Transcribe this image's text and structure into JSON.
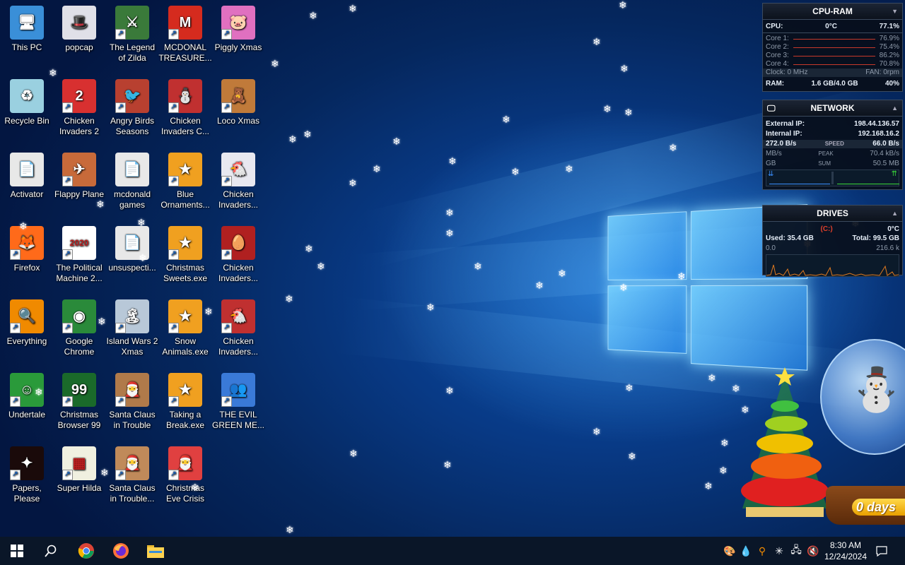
{
  "desktop_icons": [
    {
      "label": "This PC",
      "glyph": "🖥",
      "color": "#3a8fd8",
      "shortcut": false
    },
    {
      "label": "popcap",
      "glyph": "🎩",
      "color": "#e0e0e8",
      "shortcut": false
    },
    {
      "label": "The Legend of Zilda",
      "glyph": "⚔",
      "color": "#3a7a3a",
      "shortcut": true
    },
    {
      "label": "MCDONAL TREASURE...",
      "glyph": "M",
      "color": "#d52b1e",
      "shortcut": true
    },
    {
      "label": "Piggly Xmas",
      "glyph": "🐷",
      "color": "#e070c0",
      "shortcut": true
    },
    {
      "label": "Recycle Bin",
      "glyph": "♻",
      "color": "#9ad0e0",
      "shortcut": false
    },
    {
      "label": "Chicken Invaders 2",
      "glyph": "2",
      "color": "#d83030",
      "shortcut": true
    },
    {
      "label": "Angry Birds Seasons",
      "glyph": "🐦",
      "color": "#b84030",
      "shortcut": true
    },
    {
      "label": "Chicken Invaders C...",
      "glyph": "⛄",
      "color": "#c03030",
      "shortcut": true
    },
    {
      "label": "Loco Xmas",
      "glyph": "🧸",
      "color": "#c07a3a",
      "shortcut": true
    },
    {
      "label": "Activator",
      "glyph": "📄",
      "color": "#e8e8e8",
      "shortcut": false
    },
    {
      "label": "Flappy Plane",
      "glyph": "✈",
      "color": "#c86a3a",
      "shortcut": true
    },
    {
      "label": "mcdonald games",
      "glyph": "📄",
      "color": "#e8e8e8",
      "shortcut": false
    },
    {
      "label": "Blue Ornaments...",
      "glyph": "★",
      "color": "#f0a020",
      "shortcut": true
    },
    {
      "label": "Chicken Invaders...",
      "glyph": "🐔",
      "color": "#e8e8f0",
      "shortcut": true
    },
    {
      "label": "Firefox",
      "glyph": "🦊",
      "color": "#ff6a1a",
      "shortcut": true
    },
    {
      "label": "The Political Machine 2...",
      "glyph": "2020",
      "color": "#ffffff",
      "shortcut": true
    },
    {
      "label": "unsuspecti...",
      "glyph": "📄",
      "color": "#e8e8e8",
      "shortcut": false
    },
    {
      "label": "Christmas Sweets.exe",
      "glyph": "★",
      "color": "#f0a020",
      "shortcut": true
    },
    {
      "label": "Chicken Invaders...",
      "glyph": "🥚",
      "color": "#b02020",
      "shortcut": true
    },
    {
      "label": "Everything",
      "glyph": "🔍",
      "color": "#f08a00",
      "shortcut": true
    },
    {
      "label": "Google Chrome",
      "glyph": "◉",
      "color": "#2a8a3a",
      "shortcut": true
    },
    {
      "label": "Island Wars 2 Xmas",
      "glyph": "🏝",
      "color": "#b8c8d8",
      "shortcut": true
    },
    {
      "label": "Snow Animals.exe",
      "glyph": "★",
      "color": "#f0a020",
      "shortcut": true
    },
    {
      "label": "Chicken Invaders...",
      "glyph": "🐔",
      "color": "#c03030",
      "shortcut": true
    },
    {
      "label": "Undertale",
      "glyph": "☺",
      "color": "#2a9a3a",
      "shortcut": true
    },
    {
      "label": "Christmas Browser 99",
      "glyph": "99",
      "color": "#1a6a2a",
      "shortcut": true
    },
    {
      "label": "Santa Claus in Trouble",
      "glyph": "🎅",
      "color": "#b07a4a",
      "shortcut": true
    },
    {
      "label": "Taking a Break.exe",
      "glyph": "★",
      "color": "#f0a020",
      "shortcut": true
    },
    {
      "label": "THE EVIL GREEN ME...",
      "glyph": "👥",
      "color": "#3a7ad8",
      "shortcut": true
    },
    {
      "label": "Papers, Please",
      "glyph": "✦",
      "color": "#1a0a0a",
      "shortcut": true
    },
    {
      "label": "Super Hilda",
      "glyph": "▦",
      "color": "#f0f0e0",
      "shortcut": true
    },
    {
      "label": "Santa Claus in Trouble...",
      "glyph": "🎅",
      "color": "#c08a5a",
      "shortcut": true
    },
    {
      "label": "Christmas Eve Crisis",
      "glyph": "🎅",
      "color": "#e04040",
      "shortcut": true
    }
  ],
  "gadgets": {
    "cpu_ram": {
      "title": "CPU-RAM",
      "cpu_label": "CPU:",
      "cpu_temp": "0°C",
      "cpu_usage": "77.1%",
      "cores": [
        {
          "label": "Core 1:",
          "value": "76.9%"
        },
        {
          "label": "Core 2:",
          "value": "75.4%"
        },
        {
          "label": "Core 3:",
          "value": "86.2%"
        },
        {
          "label": "Core 4:",
          "value": "70.8%"
        }
      ],
      "clock": "Clock: 0 MHz",
      "fan": "FAN: 0rpm",
      "ram_label": "RAM:",
      "ram_value": "1.6 GB/4.0 GB",
      "ram_percent": "40%"
    },
    "network": {
      "title": "NETWORK",
      "external_label": "External IP:",
      "external_ip": "198.44.136.57",
      "internal_label": "Internal IP:",
      "internal_ip": "192.168.16.2",
      "down_speed": "272.0 B/s",
      "speed_label": "SPEED",
      "up_speed": "66.0 B/s",
      "down_peak": "MB/s",
      "peak_label": "PEAK",
      "up_peak": "70.4 kB/s",
      "down_sum": "GB",
      "sum_label": "SUM",
      "up_sum": "50.5 MB"
    },
    "drives": {
      "title": "DRIVES",
      "drive": "(C:)",
      "temp": "0°C",
      "used": "Used: 35.4 GB",
      "total": "Total: 99.5 GB",
      "read": "0.0",
      "write": "216.6 k"
    }
  },
  "decoration": {
    "days_text": "0 days"
  },
  "taskbar": {
    "pinned": [
      {
        "name": "start-button",
        "glyph": "⊞"
      },
      {
        "name": "search-button",
        "glyph": "⚲"
      },
      {
        "name": "chrome",
        "glyph": "◉"
      },
      {
        "name": "firefox",
        "glyph": "🦊"
      },
      {
        "name": "file-explorer",
        "glyph": "📁"
      }
    ],
    "time": "8:30 AM",
    "date": "12/24/2024"
  }
}
